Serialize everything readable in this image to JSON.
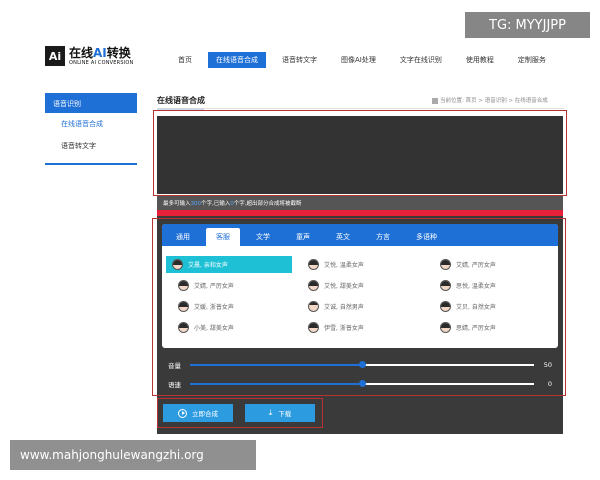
{
  "logo": {
    "mark": "Ai",
    "title_pre": "在线",
    "title_ai": "AI",
    "title_post": "转换",
    "subtitle": "ONLINE AI CONVERSION"
  },
  "nav": [
    {
      "label": "首页"
    },
    {
      "label": "在线语音合成",
      "active": true
    },
    {
      "label": "语音转文字"
    },
    {
      "label": "图像AI处理"
    },
    {
      "label": "文字在线识别"
    },
    {
      "label": "使用教程"
    },
    {
      "label": "定制服务"
    }
  ],
  "tg_badge": "TG: MYYJJPP",
  "sidebar": {
    "header": "语音识别",
    "items": [
      {
        "label": "在线语音合成",
        "active": true
      },
      {
        "label": "语音转文字"
      }
    ]
  },
  "main": {
    "title": "在线语音合成",
    "breadcrumb": "当前位置: 首页 > 语音识别 > 在线语音合成"
  },
  "textarea": {
    "value": ""
  },
  "hint": {
    "pre": "最多可输入",
    "max": "300",
    "mid": "个字,已输入",
    "count": "0",
    "post": "个字,超出部分合成将被截断"
  },
  "tabs": [
    {
      "label": "通用"
    },
    {
      "label": "客服",
      "active": true
    },
    {
      "label": "文学"
    },
    {
      "label": "童声"
    },
    {
      "label": "英文"
    },
    {
      "label": "方言"
    },
    {
      "label": "多语种"
    }
  ],
  "voices": [
    [
      {
        "label": "艾晨, 亲和女声",
        "selected": true
      },
      {
        "label": "艾悦, 温柔女声"
      },
      {
        "label": "艾婧, 严厉女声"
      }
    ],
    [
      {
        "label": "艾婧, 严厉女声"
      },
      {
        "label": "艾悦, 甜美女声"
      },
      {
        "label": "思悦, 温柔女声"
      }
    ],
    [
      {
        "label": "艾媛, 浙普女声"
      },
      {
        "label": "艾诚, 自然男声",
        "male": true
      },
      {
        "label": "艾贝, 自然女声"
      }
    ],
    [
      {
        "label": "小美, 甜美女声"
      },
      {
        "label": "伊雪, 浙普女声"
      },
      {
        "label": "思婧, 严厉女声"
      }
    ]
  ],
  "sliders": [
    {
      "label": "音量",
      "value": "50",
      "level": 0.5
    },
    {
      "label": "语速",
      "value": "0",
      "level": 0.5
    }
  ],
  "buttons": {
    "synthesize": "立即合成",
    "download": "下载"
  },
  "watermark": "www.mahjonghulewangzhi.org",
  "colors": {
    "accent": "#1e6fd6",
    "selected_voice": "#1ec0d6",
    "highlight_red": "#b83232"
  }
}
